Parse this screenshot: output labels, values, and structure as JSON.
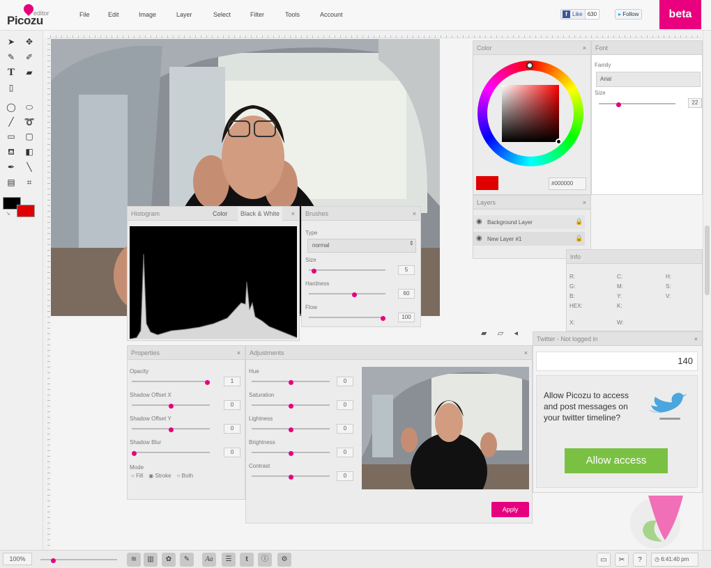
{
  "app": {
    "logo": "Picozu",
    "logo_sub": "editor",
    "beta": "beta"
  },
  "menu": [
    "File",
    "Edit",
    "Image",
    "Layer",
    "Select",
    "Filter",
    "Tools",
    "Account"
  ],
  "social": {
    "fb_like": "Like",
    "fb_count": "630",
    "follow": "Follow"
  },
  "colors": {
    "accent": "#e6007e",
    "fg": "#000000",
    "bg": "#e00000",
    "green": "#7ac143"
  },
  "color_panel": {
    "title": "Color",
    "hex_value": "#000000"
  },
  "font_panel": {
    "title": "Font",
    "family_label": "Family",
    "family_value": "Arial",
    "size_label": "Size",
    "size_value": "22"
  },
  "layers_panel": {
    "title": "Layers",
    "items": [
      "Background Layer",
      "New Layer #1"
    ]
  },
  "info_panel": {
    "title": "Info",
    "col1": [
      "R:",
      "G:",
      "B:",
      "HEX:"
    ],
    "col2": [
      "C:",
      "M:",
      "Y:",
      "K:"
    ],
    "col3": [
      "H:",
      "S:",
      "V:"
    ],
    "x_label": "X:",
    "w_label": "W:"
  },
  "histogram_panel": {
    "tabs": [
      "Histogram",
      "Color",
      "Black & White"
    ]
  },
  "brushes_panel": {
    "title": "Brushes",
    "type_label": "Type",
    "type_value": "normal",
    "fields": [
      {
        "label": "Size",
        "value": "5",
        "pct": 0.04
      },
      {
        "label": "Hardness",
        "value": "60",
        "pct": 0.6
      },
      {
        "label": "Flow",
        "value": "100",
        "pct": 1.0
      }
    ]
  },
  "properties_panel": {
    "title": "Properties",
    "fields": [
      {
        "label": "Opacity",
        "value": "1",
        "pct": 1.0
      },
      {
        "label": "Shadow Offset X",
        "value": "0",
        "pct": 0.5
      },
      {
        "label": "Shadow Offset Y",
        "value": "0",
        "pct": 0.5
      },
      {
        "label": "Shadow Blur",
        "value": "0",
        "pct": 0.0
      }
    ],
    "mode_label": "Mode",
    "modes": [
      "Fill",
      "Stroke",
      "Both"
    ],
    "mode_selected": "Stroke"
  },
  "adjustments_panel": {
    "title": "Adjustments",
    "fields": [
      {
        "label": "Hue",
        "value": "0"
      },
      {
        "label": "Saturation",
        "value": "0"
      },
      {
        "label": "Lightness",
        "value": "0"
      },
      {
        "label": "Brightness",
        "value": "0"
      },
      {
        "label": "Contrast",
        "value": "0"
      }
    ],
    "apply": "Apply"
  },
  "twitter_panel": {
    "title": "Twitter - Not logged in",
    "counter": "140",
    "message": "Allow Picozu to access and post messages on your twitter timeline?",
    "button": "Allow access"
  },
  "status": {
    "zoom": "100%",
    "zoom_pct": 0.15,
    "time": "6:41:40 pm"
  }
}
